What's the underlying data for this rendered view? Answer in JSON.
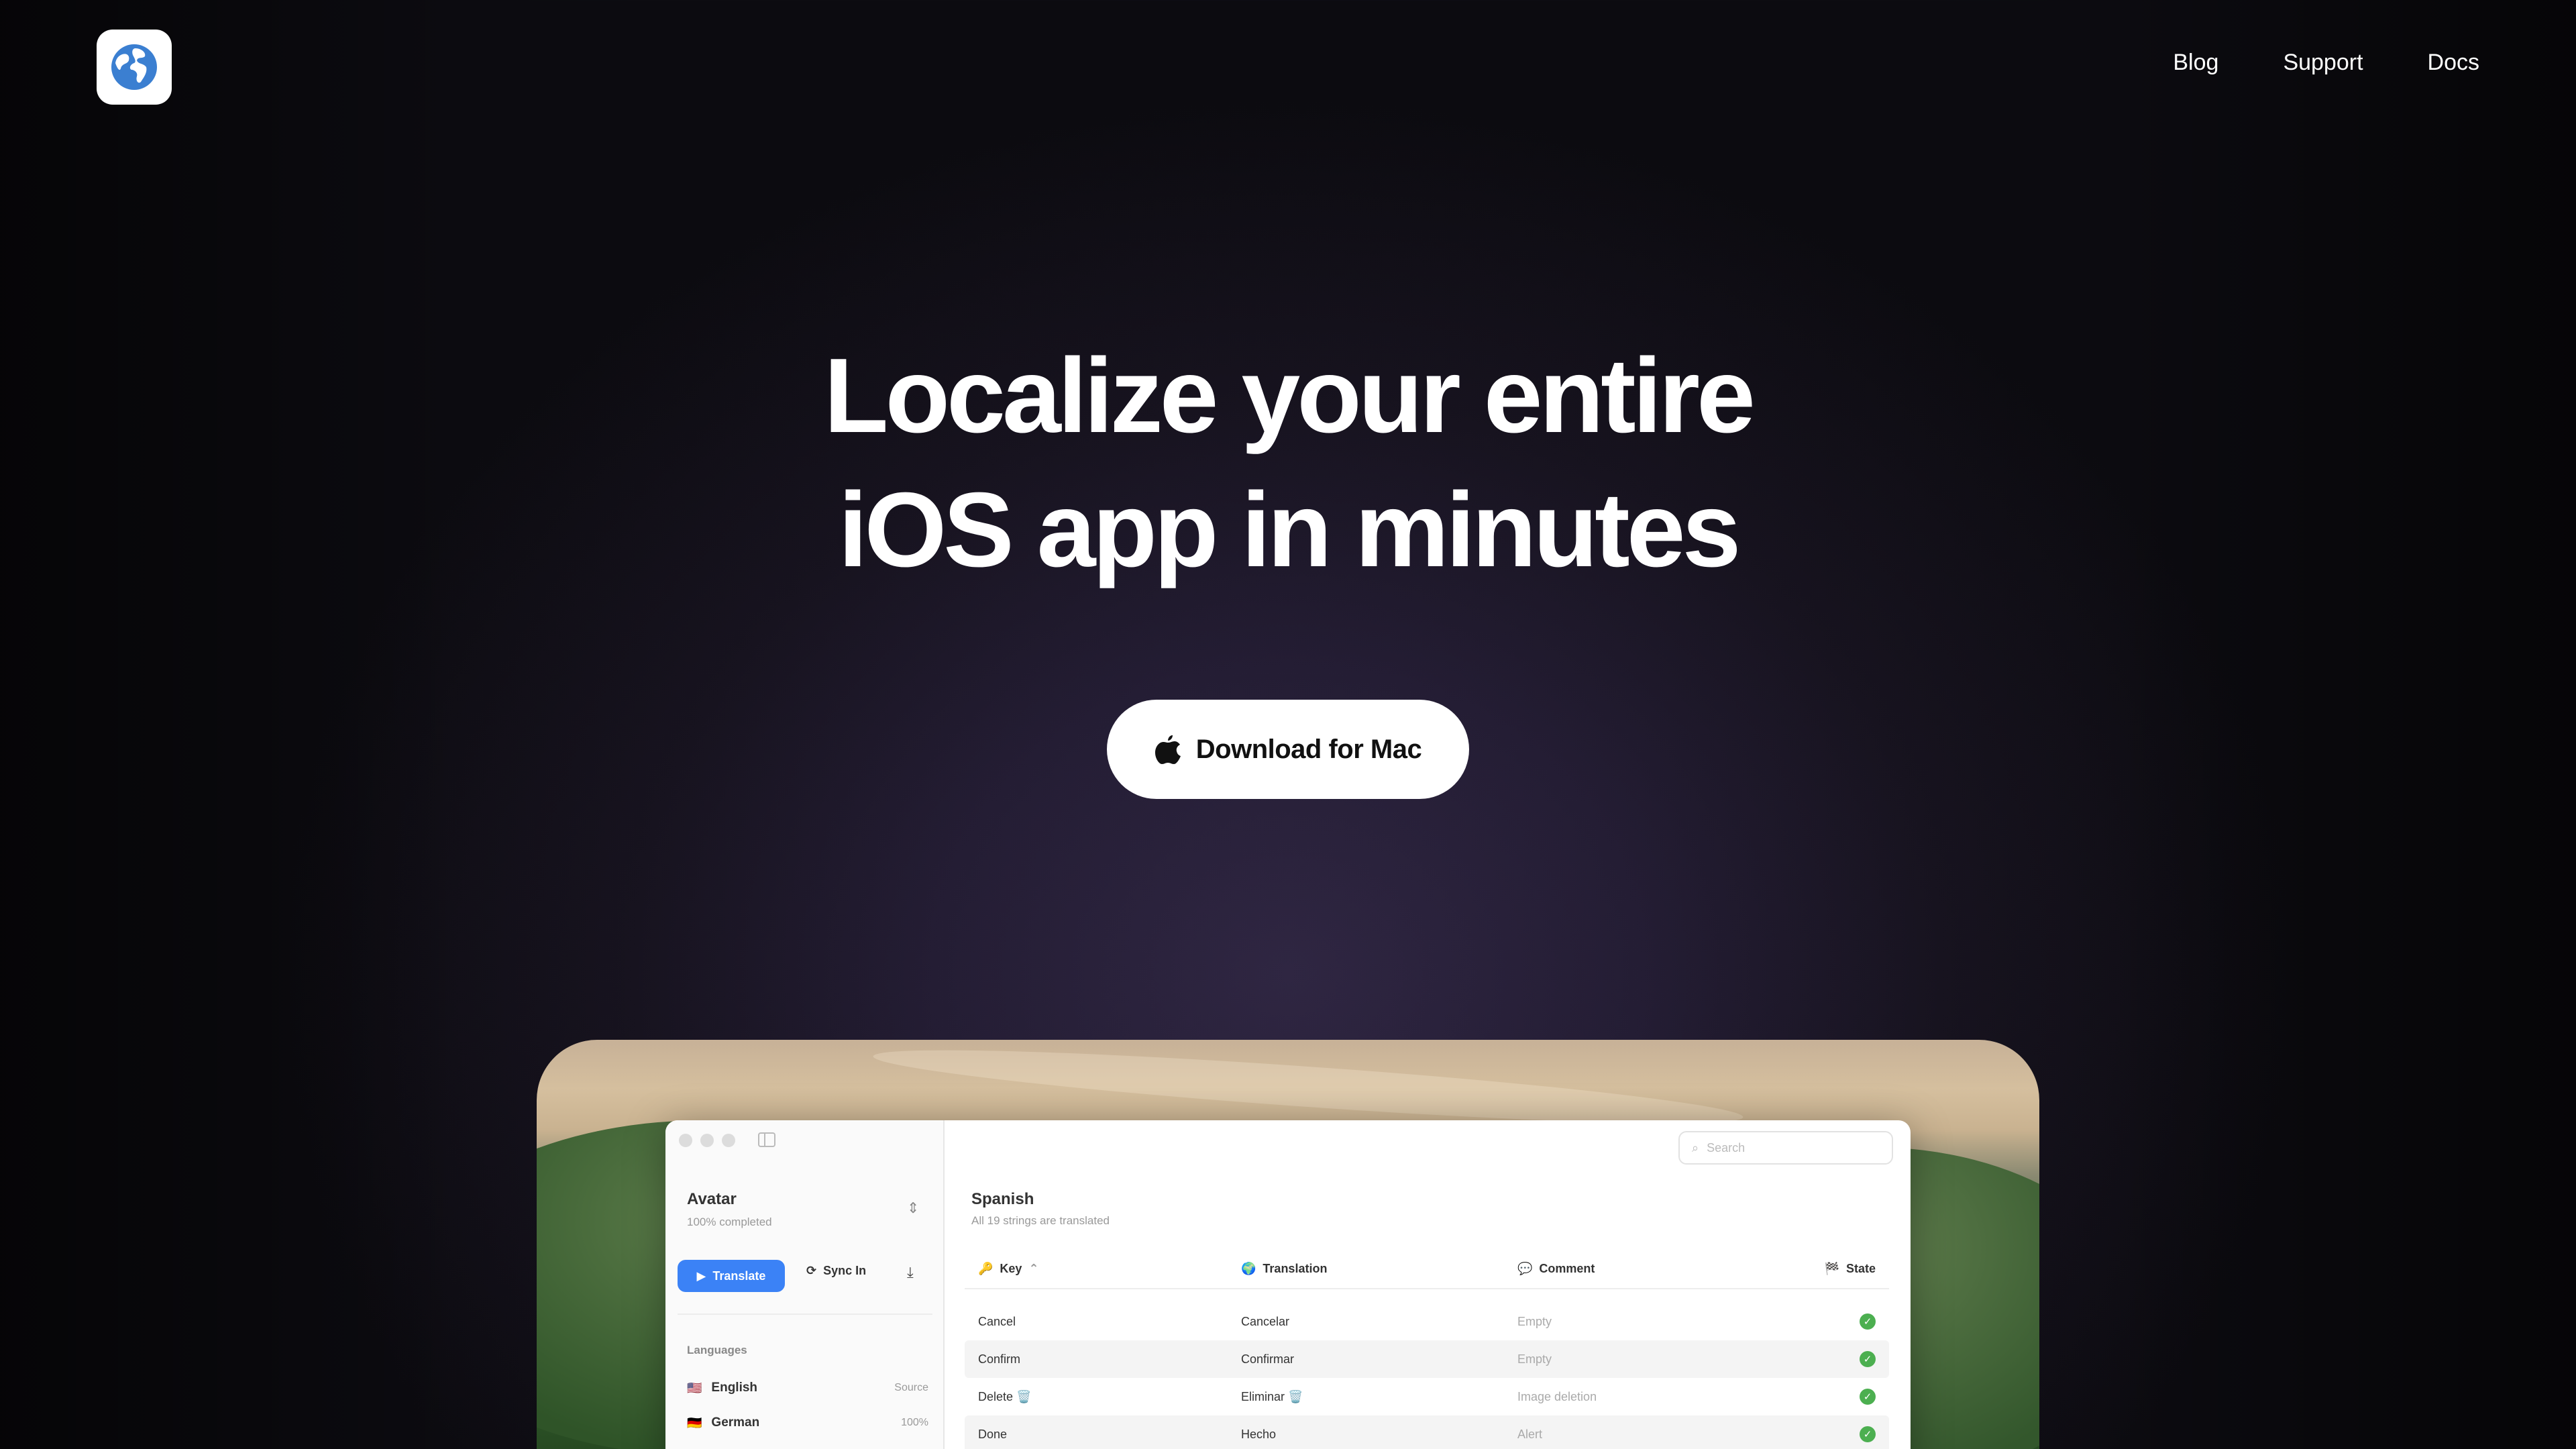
{
  "nav": {
    "links": [
      "Blog",
      "Support",
      "Docs"
    ]
  },
  "hero": {
    "title_line1": "Localize your entire",
    "title_line2": "iOS app in minutes",
    "cta_label": "Download for Mac"
  },
  "app": {
    "project": {
      "name": "Avatar",
      "progress": "100% completed"
    },
    "buttons": {
      "translate": "Translate",
      "sync": "Sync In"
    },
    "languages_header": "Languages",
    "languages": [
      {
        "flag": "🇺🇸",
        "name": "English",
        "status": "Source"
      },
      {
        "flag": "🇩🇪",
        "name": "German",
        "status": "100%"
      }
    ],
    "search_placeholder": "Search",
    "main": {
      "title": "Spanish",
      "subtitle": "All 19 strings are translated"
    },
    "columns": {
      "key": "Key",
      "translation": "Translation",
      "comment": "Comment",
      "state": "State"
    },
    "rows": [
      {
        "key": "Cancel",
        "translation": "Cancelar",
        "comment": "Empty"
      },
      {
        "key": "Confirm",
        "translation": "Confirmar",
        "comment": "Empty"
      },
      {
        "key": "Delete 🗑️",
        "translation": "Eliminar 🗑️",
        "comment": "Image deletion"
      },
      {
        "key": "Done",
        "translation": "Hecho",
        "comment": "Alert"
      }
    ]
  },
  "colors": {
    "accent": "#3b82f6",
    "success": "#4caf50",
    "background": "#1b1624"
  }
}
